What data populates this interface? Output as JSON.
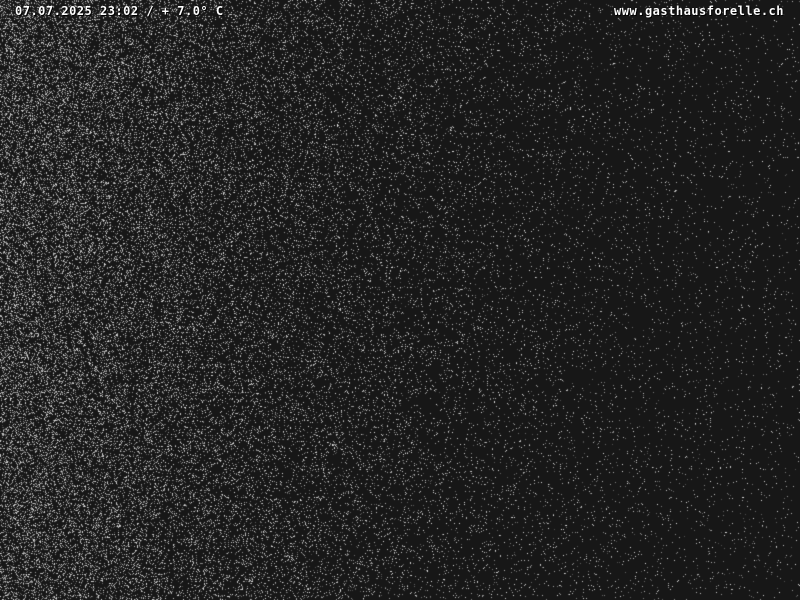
{
  "webcam": {
    "timestamp": "07.07.2025 23:02",
    "separator": "/",
    "temperature": "+ 7.0° C",
    "source_url": "www.gasthausforelle.ch"
  },
  "colors": {
    "background": "#171717",
    "noise": "#bdbdbd",
    "overlay_text": "#ffffff"
  }
}
